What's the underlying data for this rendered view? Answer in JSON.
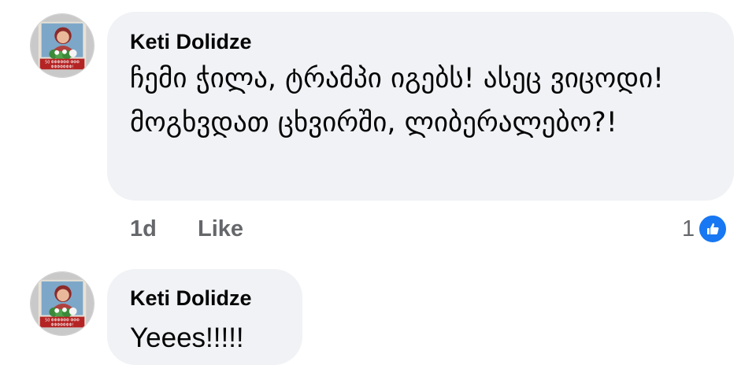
{
  "comments": [
    {
      "author": "Keti Dolidze",
      "text": "ჩემი ჭილა, ტრამპი იგებს! ასეც ვიცოდი! მოგხვდათ ცხვირში, ლიბერალებო?!",
      "time": "1d",
      "like_label": "Like",
      "reaction_count": "1",
      "avatar_caption_1": "50 ΦΦΦΦΦΦ ΦΦΦ",
      "avatar_caption_2": "ΦΦΦΦΦΦΦ!"
    },
    {
      "author": "Keti Dolidze",
      "text": "Yeees!!!!!",
      "avatar_caption_1": "50 ΦΦΦΦΦΦ ΦΦΦ",
      "avatar_caption_2": "ΦΦΦΦΦΦΦ!"
    }
  ],
  "colors": {
    "bubble": "#f0f2f5",
    "text": "#050505",
    "meta": "#65676b",
    "like_blue": "#1877f2"
  },
  "icons": {
    "reaction": "thumbs-up-icon"
  }
}
